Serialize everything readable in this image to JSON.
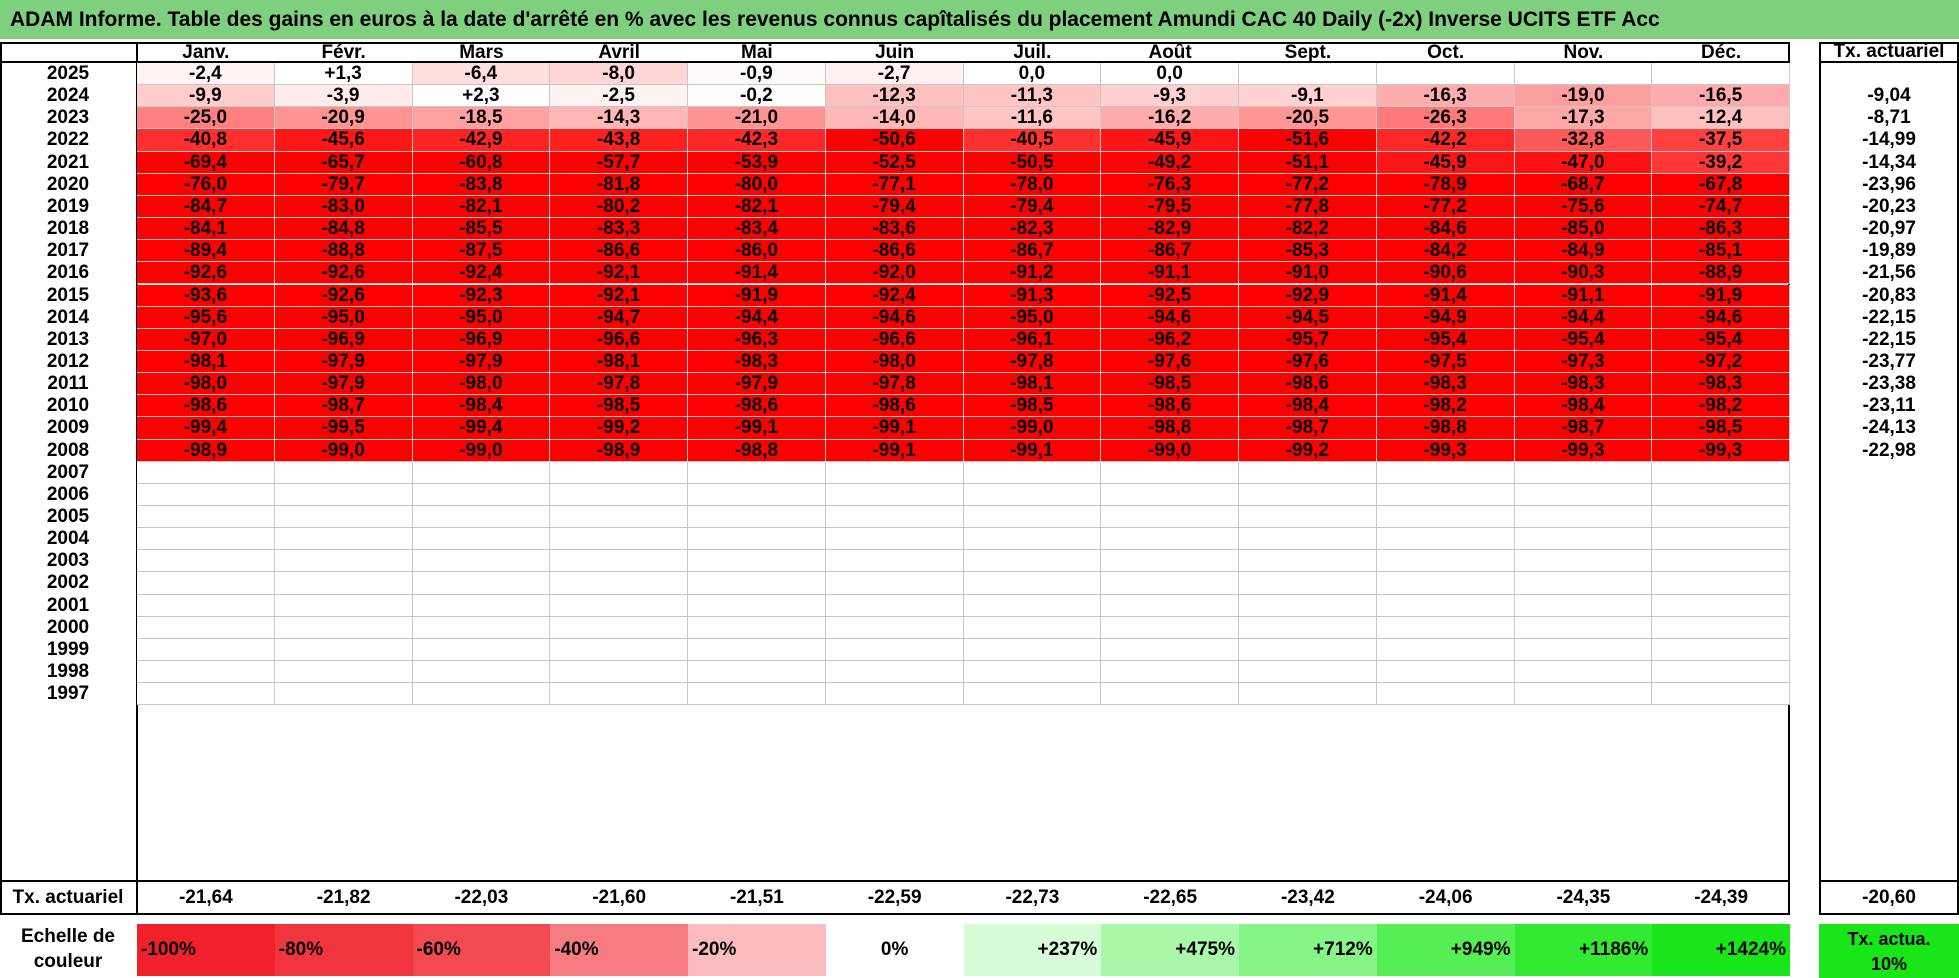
{
  "title": "ADAM Informe. Table des gains en euros à la date d'arrêté en % avec les revenus connus capîtalisés du placement Amundi CAC 40 Daily (-2x) Inverse UCITS ETF Acc",
  "months": [
    "Janv.",
    "Févr.",
    "Mars",
    "Avril",
    "Mai",
    "Juin",
    "Juil.",
    "Août",
    "Sept.",
    "Oct.",
    "Nov.",
    "Déc."
  ],
  "actuarial_header": "Tx. actuariel",
  "rows": [
    {
      "year": "2025",
      "values": [
        "-2,4",
        "+1,3",
        "-6,4",
        "-8,0",
        "-0,9",
        "-2,7",
        "0,0",
        "0,0",
        "",
        "",
        "",
        ""
      ],
      "rate": ""
    },
    {
      "year": "2024",
      "values": [
        "-9,9",
        "-3,9",
        "+2,3",
        "-2,5",
        "-0,2",
        "-12,3",
        "-11,3",
        "-9,3",
        "-9,1",
        "-16,3",
        "-19,0",
        "-16,5"
      ],
      "rate": "-9,04"
    },
    {
      "year": "2023",
      "values": [
        "-25,0",
        "-20,9",
        "-18,5",
        "-14,3",
        "-21,0",
        "-14,0",
        "-11,6",
        "-16,2",
        "-20,5",
        "-26,3",
        "-17,3",
        "-12,4"
      ],
      "rate": "-8,71"
    },
    {
      "year": "2022",
      "values": [
        "-40,8",
        "-45,6",
        "-42,9",
        "-43,8",
        "-42,3",
        "-50,6",
        "-40,5",
        "-45,9",
        "-51,6",
        "-42,2",
        "-32,8",
        "-37,5"
      ],
      "rate": "-14,99"
    },
    {
      "year": "2021",
      "values": [
        "-69,4",
        "-65,7",
        "-60,8",
        "-57,7",
        "-53,9",
        "-52,5",
        "-50,5",
        "-49,2",
        "-51,1",
        "-45,9",
        "-47,0",
        "-39,2"
      ],
      "rate": "-14,34"
    },
    {
      "year": "2020",
      "values": [
        "-76,0",
        "-79,7",
        "-83,8",
        "-81,8",
        "-80,0",
        "-77,1",
        "-78,0",
        "-76,3",
        "-77,2",
        "-78,9",
        "-68,7",
        "-67,8"
      ],
      "rate": "-23,96"
    },
    {
      "year": "2019",
      "values": [
        "-84,7",
        "-83,0",
        "-82,1",
        "-80,2",
        "-82,1",
        "-79,4",
        "-79,4",
        "-79,5",
        "-77,8",
        "-77,2",
        "-75,6",
        "-74,7"
      ],
      "rate": "-20,23"
    },
    {
      "year": "2018",
      "values": [
        "-84,1",
        "-84,8",
        "-85,5",
        "-83,3",
        "-83,4",
        "-83,6",
        "-82,3",
        "-82,9",
        "-82,2",
        "-84,6",
        "-85,0",
        "-86,3"
      ],
      "rate": "-20,97"
    },
    {
      "year": "2017",
      "values": [
        "-89,4",
        "-88,8",
        "-87,5",
        "-86,6",
        "-86,0",
        "-86,6",
        "-86,7",
        "-86,7",
        "-85,3",
        "-84,2",
        "-84,9",
        "-85,1"
      ],
      "rate": "-19,89"
    },
    {
      "year": "2016",
      "values": [
        "-92,6",
        "-92,6",
        "-92,4",
        "-92,1",
        "-91,4",
        "-92,0",
        "-91,2",
        "-91,1",
        "-91,0",
        "-90,6",
        "-90,3",
        "-88,9"
      ],
      "rate": "-21,56"
    },
    {
      "year": "2015",
      "values": [
        "-93,6",
        "-92,6",
        "-92,3",
        "-92,1",
        "-91,9",
        "-92,4",
        "-91,3",
        "-92,5",
        "-92,9",
        "-91,4",
        "-91,1",
        "-91,9"
      ],
      "rate": "-20,83"
    },
    {
      "year": "2014",
      "values": [
        "-95,6",
        "-95,0",
        "-95,0",
        "-94,7",
        "-94,4",
        "-94,6",
        "-95,0",
        "-94,6",
        "-94,5",
        "-94,9",
        "-94,4",
        "-94,6"
      ],
      "rate": "-22,15"
    },
    {
      "year": "2013",
      "values": [
        "-97,0",
        "-96,9",
        "-96,9",
        "-96,6",
        "-96,3",
        "-96,6",
        "-96,1",
        "-96,2",
        "-95,7",
        "-95,4",
        "-95,4",
        "-95,4"
      ],
      "rate": "-22,15"
    },
    {
      "year": "2012",
      "values": [
        "-98,1",
        "-97,9",
        "-97,9",
        "-98,1",
        "-98,3",
        "-98,0",
        "-97,8",
        "-97,6",
        "-97,6",
        "-97,5",
        "-97,3",
        "-97,2"
      ],
      "rate": "-23,77"
    },
    {
      "year": "2011",
      "values": [
        "-98,0",
        "-97,9",
        "-98,0",
        "-97,8",
        "-97,9",
        "-97,8",
        "-98,1",
        "-98,5",
        "-98,6",
        "-98,3",
        "-98,3",
        "-98,3"
      ],
      "rate": "-23,38"
    },
    {
      "year": "2010",
      "values": [
        "-98,6",
        "-98,7",
        "-98,4",
        "-98,5",
        "-98,6",
        "-98,6",
        "-98,5",
        "-98,6",
        "-98,4",
        "-98,2",
        "-98,4",
        "-98,2"
      ],
      "rate": "-23,11"
    },
    {
      "year": "2009",
      "values": [
        "-99,4",
        "-99,5",
        "-99,4",
        "-99,2",
        "-99,1",
        "-99,1",
        "-99,0",
        "-98,8",
        "-98,7",
        "-98,8",
        "-98,7",
        "-98,5"
      ],
      "rate": "-24,13"
    },
    {
      "year": "2008",
      "values": [
        "-98,9",
        "-99,0",
        "-99,0",
        "-98,9",
        "-98,8",
        "-99,1",
        "-99,1",
        "-99,0",
        "-99,2",
        "-99,3",
        "-99,3",
        "-99,3"
      ],
      "rate": "-22,98"
    },
    {
      "year": "2007",
      "values": [
        "",
        "",
        "",
        "",
        "",
        "",
        "",
        "",
        "",
        "",
        "",
        ""
      ],
      "rate": ""
    },
    {
      "year": "2006",
      "values": [
        "",
        "",
        "",
        "",
        "",
        "",
        "",
        "",
        "",
        "",
        "",
        ""
      ],
      "rate": ""
    },
    {
      "year": "2005",
      "values": [
        "",
        "",
        "",
        "",
        "",
        "",
        "",
        "",
        "",
        "",
        "",
        ""
      ],
      "rate": ""
    },
    {
      "year": "2004",
      "values": [
        "",
        "",
        "",
        "",
        "",
        "",
        "",
        "",
        "",
        "",
        "",
        ""
      ],
      "rate": ""
    },
    {
      "year": "2003",
      "values": [
        "",
        "",
        "",
        "",
        "",
        "",
        "",
        "",
        "",
        "",
        "",
        ""
      ],
      "rate": ""
    },
    {
      "year": "2002",
      "values": [
        "",
        "",
        "",
        "",
        "",
        "",
        "",
        "",
        "",
        "",
        "",
        ""
      ],
      "rate": ""
    },
    {
      "year": "2001",
      "values": [
        "",
        "",
        "",
        "",
        "",
        "",
        "",
        "",
        "",
        "",
        "",
        ""
      ],
      "rate": ""
    },
    {
      "year": "2000",
      "values": [
        "",
        "",
        "",
        "",
        "",
        "",
        "",
        "",
        "",
        "",
        "",
        ""
      ],
      "rate": ""
    },
    {
      "year": "1999",
      "values": [
        "",
        "",
        "",
        "",
        "",
        "",
        "",
        "",
        "",
        "",
        "",
        ""
      ],
      "rate": ""
    },
    {
      "year": "1998",
      "values": [
        "",
        "",
        "",
        "",
        "",
        "",
        "",
        "",
        "",
        "",
        "",
        ""
      ],
      "rate": ""
    },
    {
      "year": "1997",
      "values": [
        "",
        "",
        "",
        "",
        "",
        "",
        "",
        "",
        "",
        "",
        "",
        ""
      ],
      "rate": ""
    }
  ],
  "footer": {
    "label": "Tx. actuariel",
    "values": [
      "-21,64",
      "-21,82",
      "-22,03",
      "-21,60",
      "-21,51",
      "-22,59",
      "-22,73",
      "-22,65",
      "-23,42",
      "-24,06",
      "-24,35",
      "-24,39"
    ],
    "overall": "-20,60"
  },
  "scale": {
    "label": "Echelle de couleur",
    "items": [
      {
        "label": "-100%",
        "color": "#f0212b"
      },
      {
        "label": "-80%",
        "color": "#f1353e"
      },
      {
        "label": "-60%",
        "color": "#f34a52"
      },
      {
        "label": "-40%",
        "color": "#f67c82"
      },
      {
        "label": "-20%",
        "color": "#fbbcc0"
      },
      {
        "label": "0%",
        "color": "#ffffff"
      },
      {
        "label": "+237%",
        "color": "#d7fcd7"
      },
      {
        "label": "+475%",
        "color": "#aaf8aa"
      },
      {
        "label": "+712%",
        "color": "#86f486"
      },
      {
        "label": "+949%",
        "color": "#55ef55"
      },
      {
        "label": "+1186%",
        "color": "#33ea33"
      },
      {
        "label": "+1424%",
        "color": "#19e619"
      }
    ],
    "green_label": "Tx. actua. 10%",
    "green_color": "#19e619"
  },
  "colors": {
    "title_bar": "#7ecf7e",
    "strong_red": "#ff0000",
    "white": "#ffffff"
  }
}
